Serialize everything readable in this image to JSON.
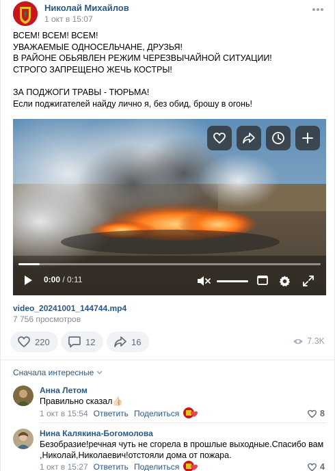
{
  "post": {
    "author": "Николай Михайлов",
    "date": "1 окт в 15:07",
    "more_icon": "more-dots-icon",
    "text_lines": [
      "ВСЕМ! ВСЕМ! ВСЕМ!",
      "УВАЖАЕМЫЕ ОДНОСЕЛЬЧАНЕ, ДРУЗЬЯ!",
      "В РАЙОНЕ ОБЬЯВЛЕН РЕЖИМ ЧЕРЕЗВЫЧАЙНОЙ СИТУАЦИИ!",
      "СТРОГО ЗАПРЕЩЕНО ЖЕЧЬ КОСТРЫ!",
      "",
      "ЗА ПОДЖОГИ ТРАВЫ - ТЮРЬМА!",
      "Если поджигателей найду лично я, без обид, брошу в огонь!"
    ]
  },
  "video": {
    "current_time": "0:00",
    "separator": " / ",
    "duration": "0:11",
    "progress_fraction": 0.07,
    "volume_fraction": 1.0,
    "overlay_buttons": [
      "heart-icon",
      "share-icon",
      "clock-icon",
      "plus-icon"
    ],
    "file_name": "video_20241001_144744.mp4",
    "views": "7 756 просмотров"
  },
  "actions": {
    "likes": "220",
    "comments": "12",
    "shares": "16",
    "views": "7.3K"
  },
  "comments_sort": "Сначала интересные",
  "comments": [
    {
      "author": "Анна Летом",
      "text_lines": [
        "Правильно сказал👍🏻"
      ],
      "date": "1 окт в 15:54",
      "reply": "Ответить",
      "share": "Поделиться",
      "likes": "8"
    },
    {
      "author": "Нина Калякина-Богомолова",
      "text_lines": [
        "Безобразие!речная чуть не сгорела в прошлые выходные.Спасибо вам",
        ",Николай,Николаевич!отстояли дома от пожара."
      ],
      "date": "1 окт в 15:27",
      "reply": "Ответить",
      "share": "Поделиться",
      "likes": "4"
    }
  ],
  "colors": {
    "link": "#2a5885",
    "secondary": "#818c99",
    "action_bg": "#f0f2f5"
  }
}
